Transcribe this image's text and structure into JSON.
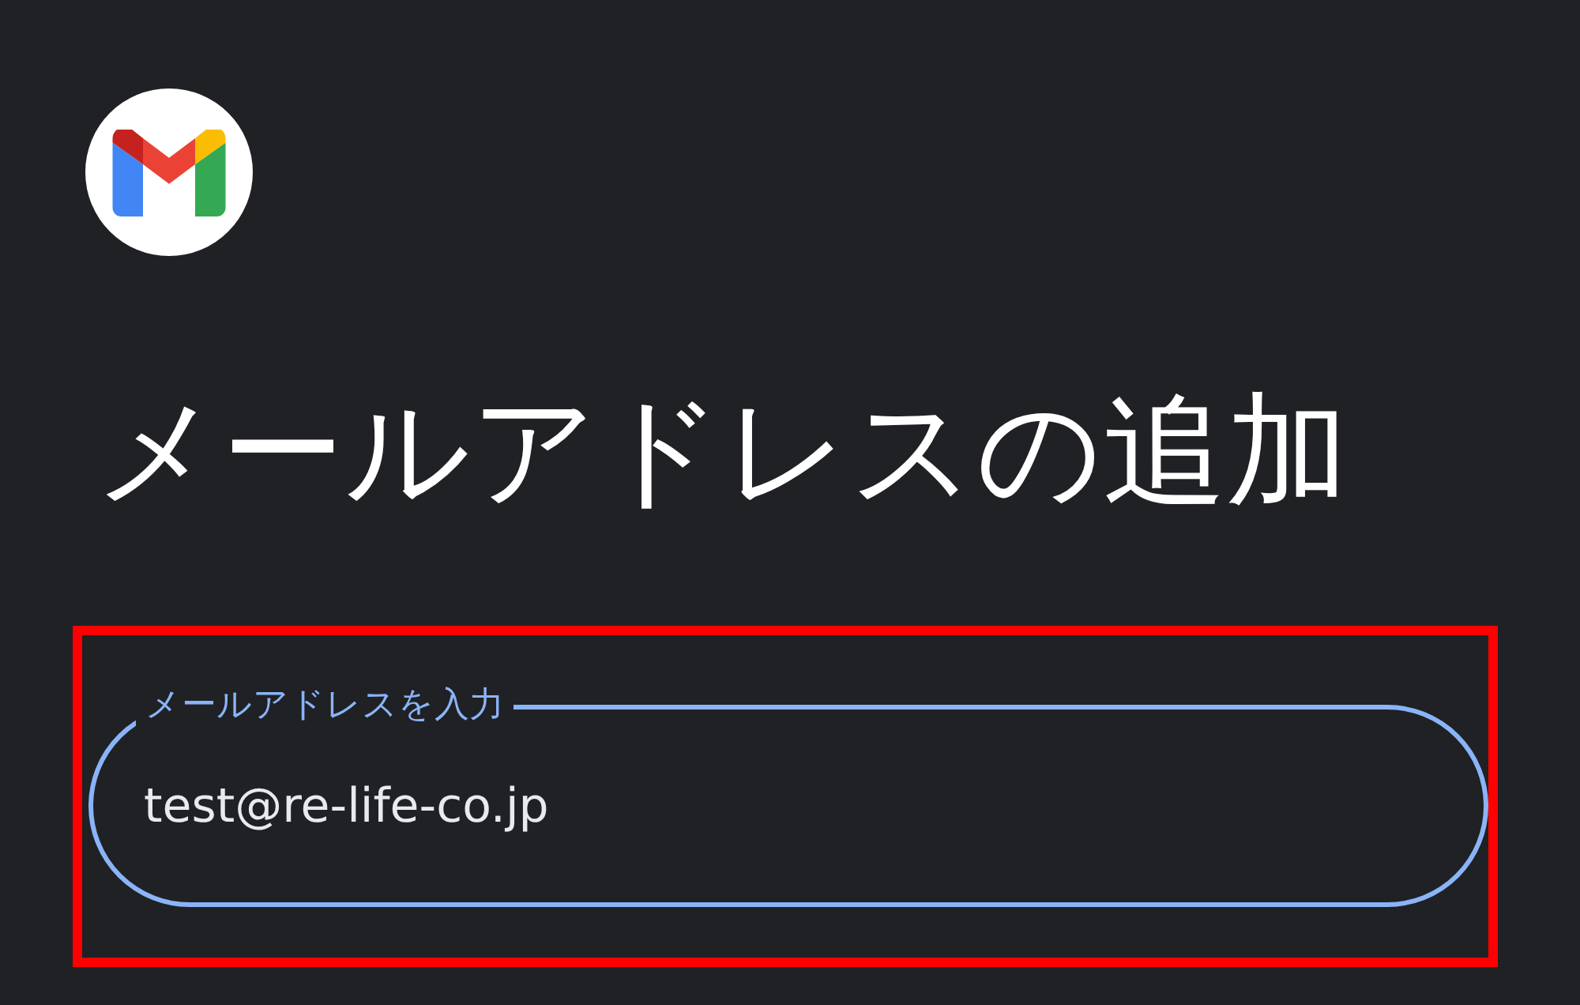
{
  "title": "メールアドレスの追加",
  "email_field": {
    "label": "メールアドレスを入力",
    "value": "test@re-life-co.jp"
  }
}
